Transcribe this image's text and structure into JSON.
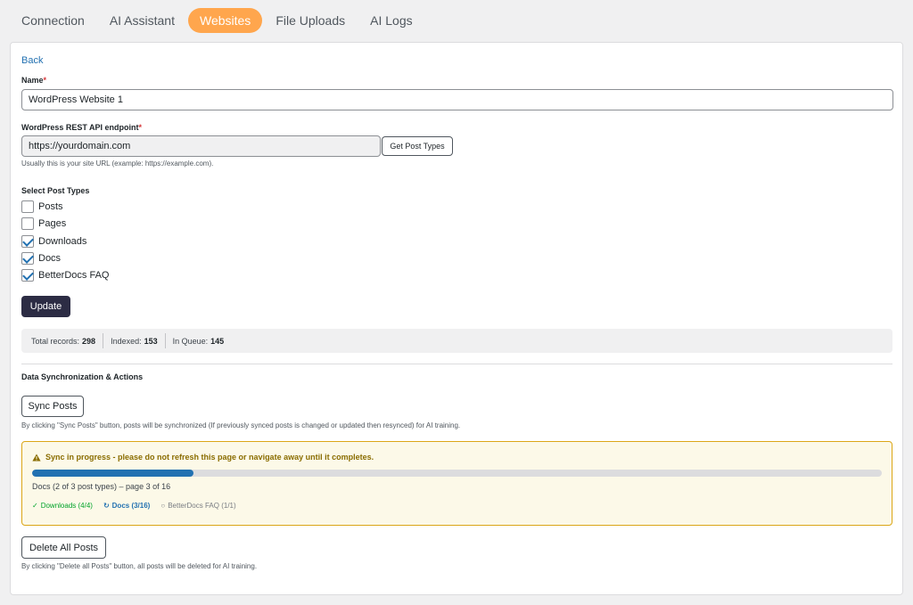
{
  "tabs": [
    {
      "label": "Connection",
      "active": false
    },
    {
      "label": "AI Assistant",
      "active": false
    },
    {
      "label": "Websites",
      "active": true
    },
    {
      "label": "File Uploads",
      "active": false
    },
    {
      "label": "AI Logs",
      "active": false
    }
  ],
  "back_label": "Back",
  "name_field": {
    "label": "Name",
    "required_mark": "*",
    "value": "WordPress Website 1"
  },
  "endpoint_field": {
    "label": "WordPress REST API endpoint",
    "required_mark": "*",
    "value": "https://yourdomain.com",
    "button_label": "Get Post Types",
    "help": "Usually this is your site URL (example: https://example.com)."
  },
  "post_types": {
    "label": "Select Post Types",
    "items": [
      {
        "label": "Posts",
        "checked": false
      },
      {
        "label": "Pages",
        "checked": false
      },
      {
        "label": "Downloads",
        "checked": true
      },
      {
        "label": "Docs",
        "checked": true
      },
      {
        "label": "BetterDocs FAQ",
        "checked": true
      }
    ]
  },
  "update_label": "Update",
  "stats": {
    "total_label": "Total records:",
    "total_value": "298",
    "indexed_label": "Indexed:",
    "indexed_value": "153",
    "queue_label": "In Queue:",
    "queue_value": "145"
  },
  "sync_section": {
    "title": "Data Synchronization & Actions",
    "sync_button": "Sync Posts",
    "sync_help": "By clicking \"Sync Posts\" button, posts will be synchronized (If previously synced posts is changed or updated then resynced) for AI training."
  },
  "sync_notice": {
    "title": "Sync in progress - please do not refresh this page or navigate away until it completes.",
    "progress_fraction": 0.19,
    "progress_text": "Docs (2 of 3 post types) – page 3 of 16",
    "items": [
      {
        "icon": "✓",
        "label": "Downloads (4/4)",
        "state": "done"
      },
      {
        "icon": "↻",
        "label": "Docs (3/16)",
        "state": "active"
      },
      {
        "icon": "○",
        "label": "BetterDocs FAQ (1/1)",
        "state": "pending"
      }
    ],
    "colors": {
      "background": "#fcf9e8",
      "border": "#dba617",
      "progress": "#2271b1"
    }
  },
  "delete_section": {
    "button": "Delete All Posts",
    "help": "By clicking \"Delete all Posts\" button, all posts will be deleted for AI training."
  },
  "accent_color": "#ffa64d"
}
